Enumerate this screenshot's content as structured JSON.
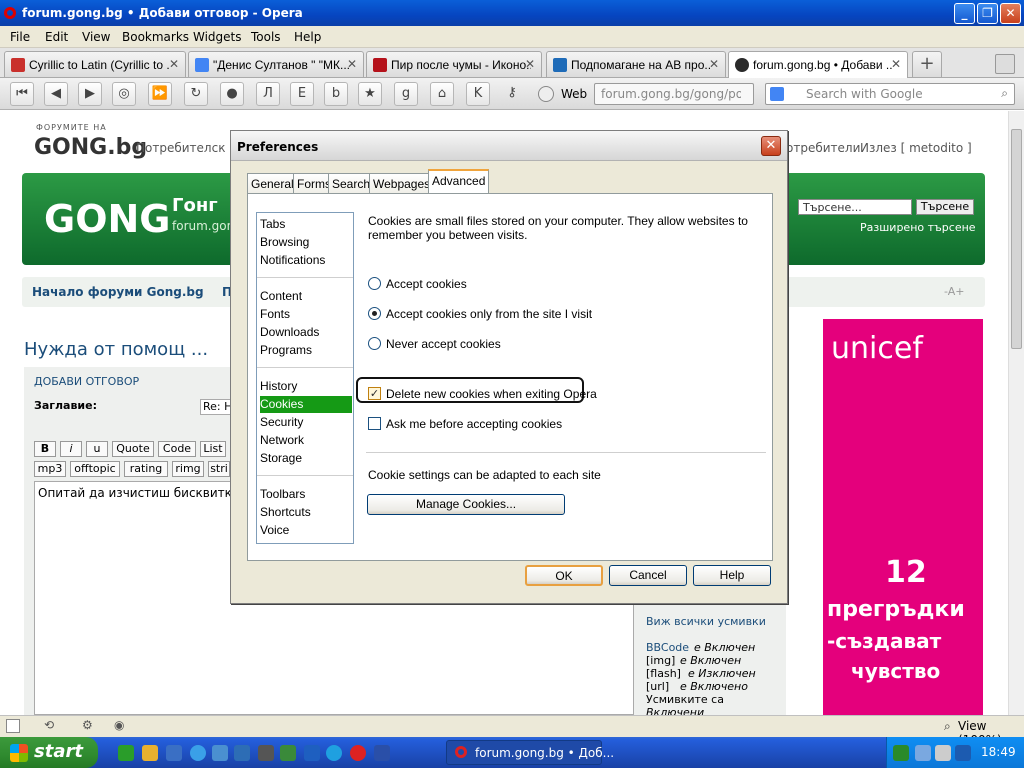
{
  "window": {
    "title": "forum.gong.bg • Добави отговор - Opera"
  },
  "menu": [
    "File",
    "Edit",
    "View",
    "Bookmarks",
    "Widgets",
    "Tools",
    "Help"
  ],
  "tabs": [
    {
      "label": "Cyrillic to Latin (Cyrillic to ...",
      "fav_color": "#c9302c",
      "active": false
    },
    {
      "label": "\"Денис Султанов \" \"МК...",
      "fav_color": "#4285f4",
      "active": false
    },
    {
      "label": "Пир после чумы - Иконо...",
      "fav_color": "#b5121b",
      "active": false
    },
    {
      "label": "Подпомагане на АВ про...",
      "fav_color": "#1e6bb8",
      "active": false
    },
    {
      "label": "forum.gong.bg • Добави ...",
      "fav_color": "#2a2a2a",
      "active": true
    }
  ],
  "toolbar": {
    "web_label": "Web",
    "address": "forum.gong.bg/gong/posting.p",
    "search_placeholder": "Search with Google"
  },
  "page": {
    "forum_label": "ФОРУМИТЕ НА",
    "logo": "GONG.bg",
    "users_link": "Потребителск",
    "users_link_right": "отребители",
    "logout": "Излез [ metodito ]",
    "site_name": "Гонг",
    "site_sub": "forum.gon",
    "search_placeholder": "Търсене...",
    "search_button": "Търсене",
    "advanced_search": "Разширено търсене",
    "breadcrumb_home": "Начало форуми Gong.bg",
    "breadcrumb_more": "П",
    "font_size_ctrl": "-A+",
    "topic_title": "Нужда от помощ ...",
    "add_reply": "ДОБАВИ ОТГОВОР",
    "subject_label": "Заглавие:",
    "subject_value": "Re: H",
    "format_buttons": [
      "B",
      "i",
      "u",
      "Quote",
      "Code",
      "List"
    ],
    "format_buttons2": [
      "mp3",
      "offtopic",
      "rating",
      "rimg",
      "stri"
    ],
    "message_text": "Опитай да изчистиш бисквитки",
    "smilies_link": "Виж всички усмивки",
    "bbcode_info": [
      {
        "key": "BBCode",
        "val": "е Включен"
      },
      {
        "key": "[img]",
        "val": "е Включен"
      },
      {
        "key": "[flash]",
        "val": "е Изключен"
      },
      {
        "key": "[url]",
        "val": "е Включено"
      },
      {
        "key": "Усмивките са",
        "val": ""
      },
      {
        "key": "Включени",
        "val": ""
      }
    ],
    "ad": {
      "brand": "unicef",
      "number": "12",
      "line1": "прегръдки",
      "line2": "-създават",
      "line3": "чувство"
    }
  },
  "dialog": {
    "title": "Preferences",
    "tabs": [
      "General",
      "Forms",
      "Search",
      "Webpages",
      "Advanced"
    ],
    "active_tab": "Advanced",
    "categories": [
      "Tabs",
      "Browsing",
      "Notifications",
      "Content",
      "Fonts",
      "Downloads",
      "Programs",
      "History",
      "Cookies",
      "Security",
      "Network",
      "Storage",
      "Toolbars",
      "Shortcuts",
      "Voice"
    ],
    "selected_category": "Cookies",
    "description": "Cookies are small files stored on your computer. They allow websites to remember you between visits.",
    "radios": [
      {
        "label": "Accept cookies",
        "checked": false
      },
      {
        "label": "Accept cookies only from the site I visit",
        "checked": true
      },
      {
        "label": "Never accept cookies",
        "checked": false
      }
    ],
    "checkboxes": [
      {
        "label": "Delete new cookies when exiting Opera",
        "checked": true
      },
      {
        "label": "Ask me before accepting cookies",
        "checked": false
      }
    ],
    "cookie_note": "Cookie settings can be adapted to each site",
    "manage_button": "Manage Cookies...",
    "ok": "OK",
    "cancel": "Cancel",
    "help": "Help"
  },
  "status": {
    "zoom": "View (100%)"
  },
  "taskbar": {
    "start": "start",
    "task_label": "forum.gong.bg • Доб...",
    "clock": "18:49"
  }
}
